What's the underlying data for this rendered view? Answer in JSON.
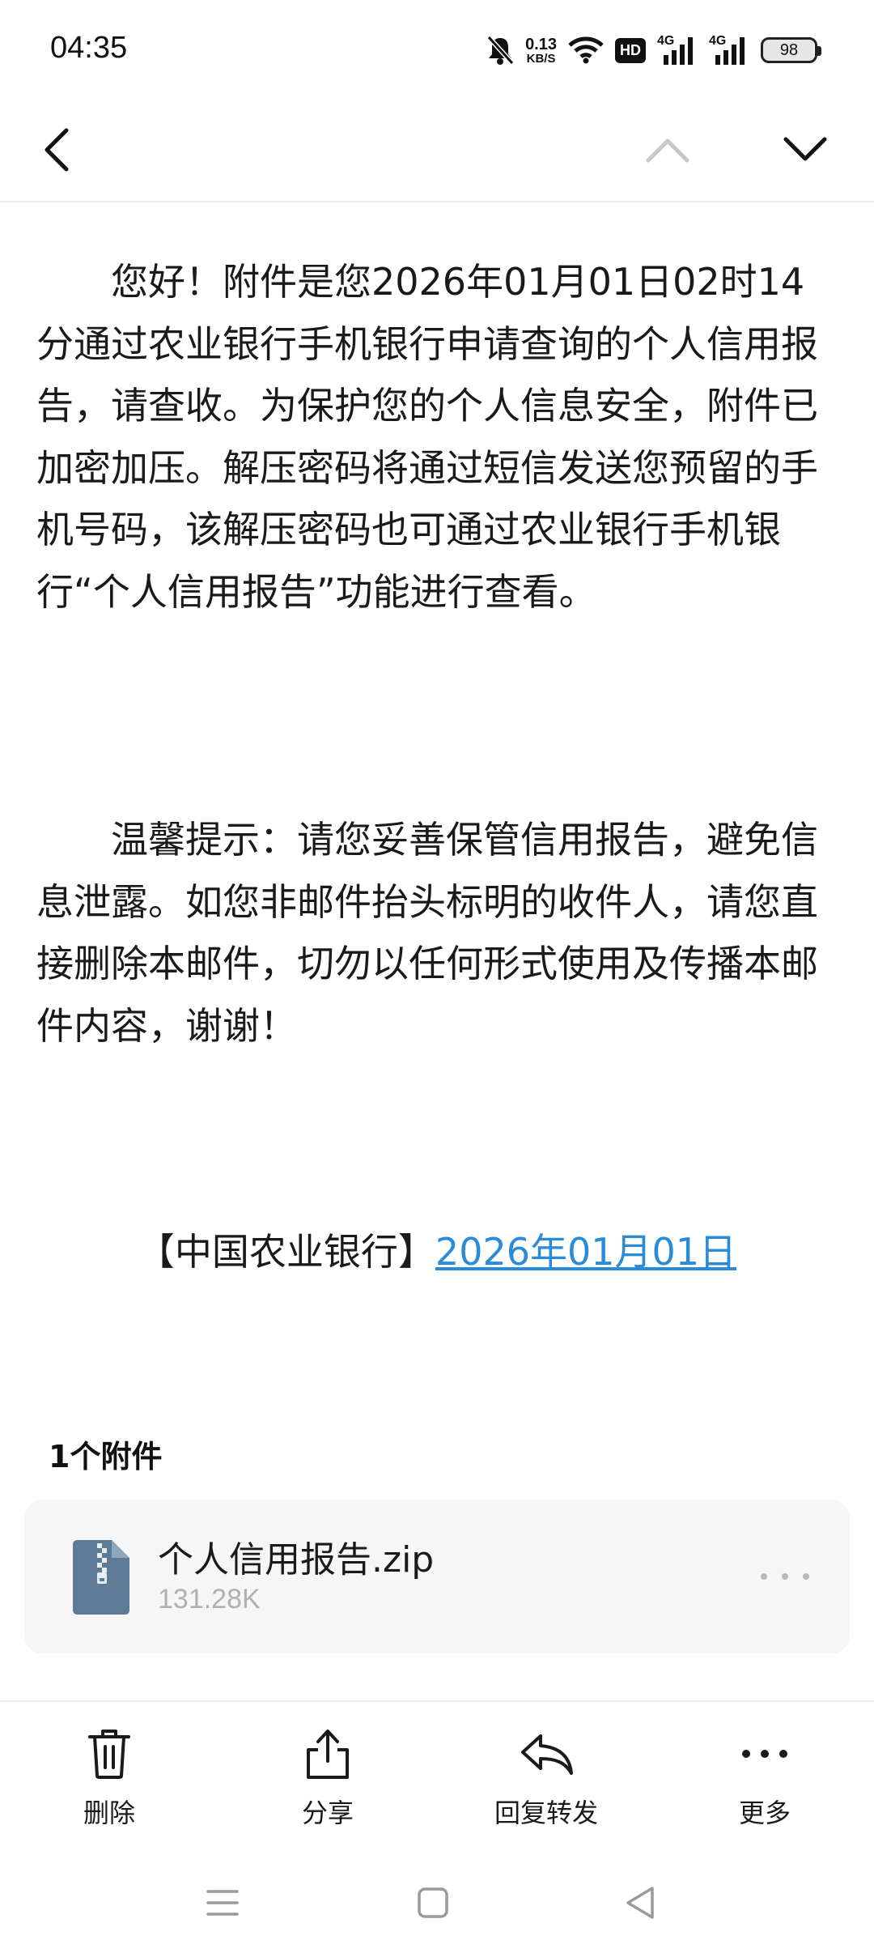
{
  "status_bar": {
    "time": "04:35",
    "net_speed_value": "0.13",
    "net_speed_unit": "KB/S",
    "hd_label": "HD",
    "signal_label_1": "4G",
    "signal_label_2": "4G",
    "battery": "98",
    "icons": [
      "bell-muted-icon",
      "wifi-icon",
      "hd-voice-icon",
      "signal-icon",
      "signal-icon",
      "battery-icon"
    ]
  },
  "nav": {
    "icons": [
      "back-chevron-icon",
      "chevron-up-icon",
      "chevron-down-icon"
    ]
  },
  "email": {
    "paragraph1": "您好！附件是您2026年01月01日02时14分通过农业银行手机银行申请查询的个人信用报告，请查收。为保护您的个人信息安全，附件已加密加压。解压密码将通过短信发送您预留的手机号码，该解压密码也可通过农业银行手机银行“个人信用报告”功能进行查看。",
    "paragraph2": "温馨提示：请您妥善保管信用报告，避免信息泄露。如您非邮件抬头标明的收件人，请您直接删除本邮件，切勿以任何形式使用及传播本邮件内容，谢谢！",
    "signature_bank": "【中国农业银行】",
    "signature_date": "2026年01月01日"
  },
  "attachments": {
    "header": "1个附件",
    "items": [
      {
        "name": "个人信用报告.zip",
        "size": "131.28K",
        "icon": "zip-file-icon"
      }
    ]
  },
  "actions": [
    {
      "label": "删除",
      "icon": "trash-icon"
    },
    {
      "label": "分享",
      "icon": "share-icon"
    },
    {
      "label": "回复转发",
      "icon": "reply-icon"
    },
    {
      "label": "更多",
      "icon": "more-icon"
    }
  ],
  "colors": {
    "link": "#2a8bd8",
    "file_icon": "#5d7b96",
    "muted_text": "#b0b0b0",
    "card_bg": "#f6f6f6"
  }
}
